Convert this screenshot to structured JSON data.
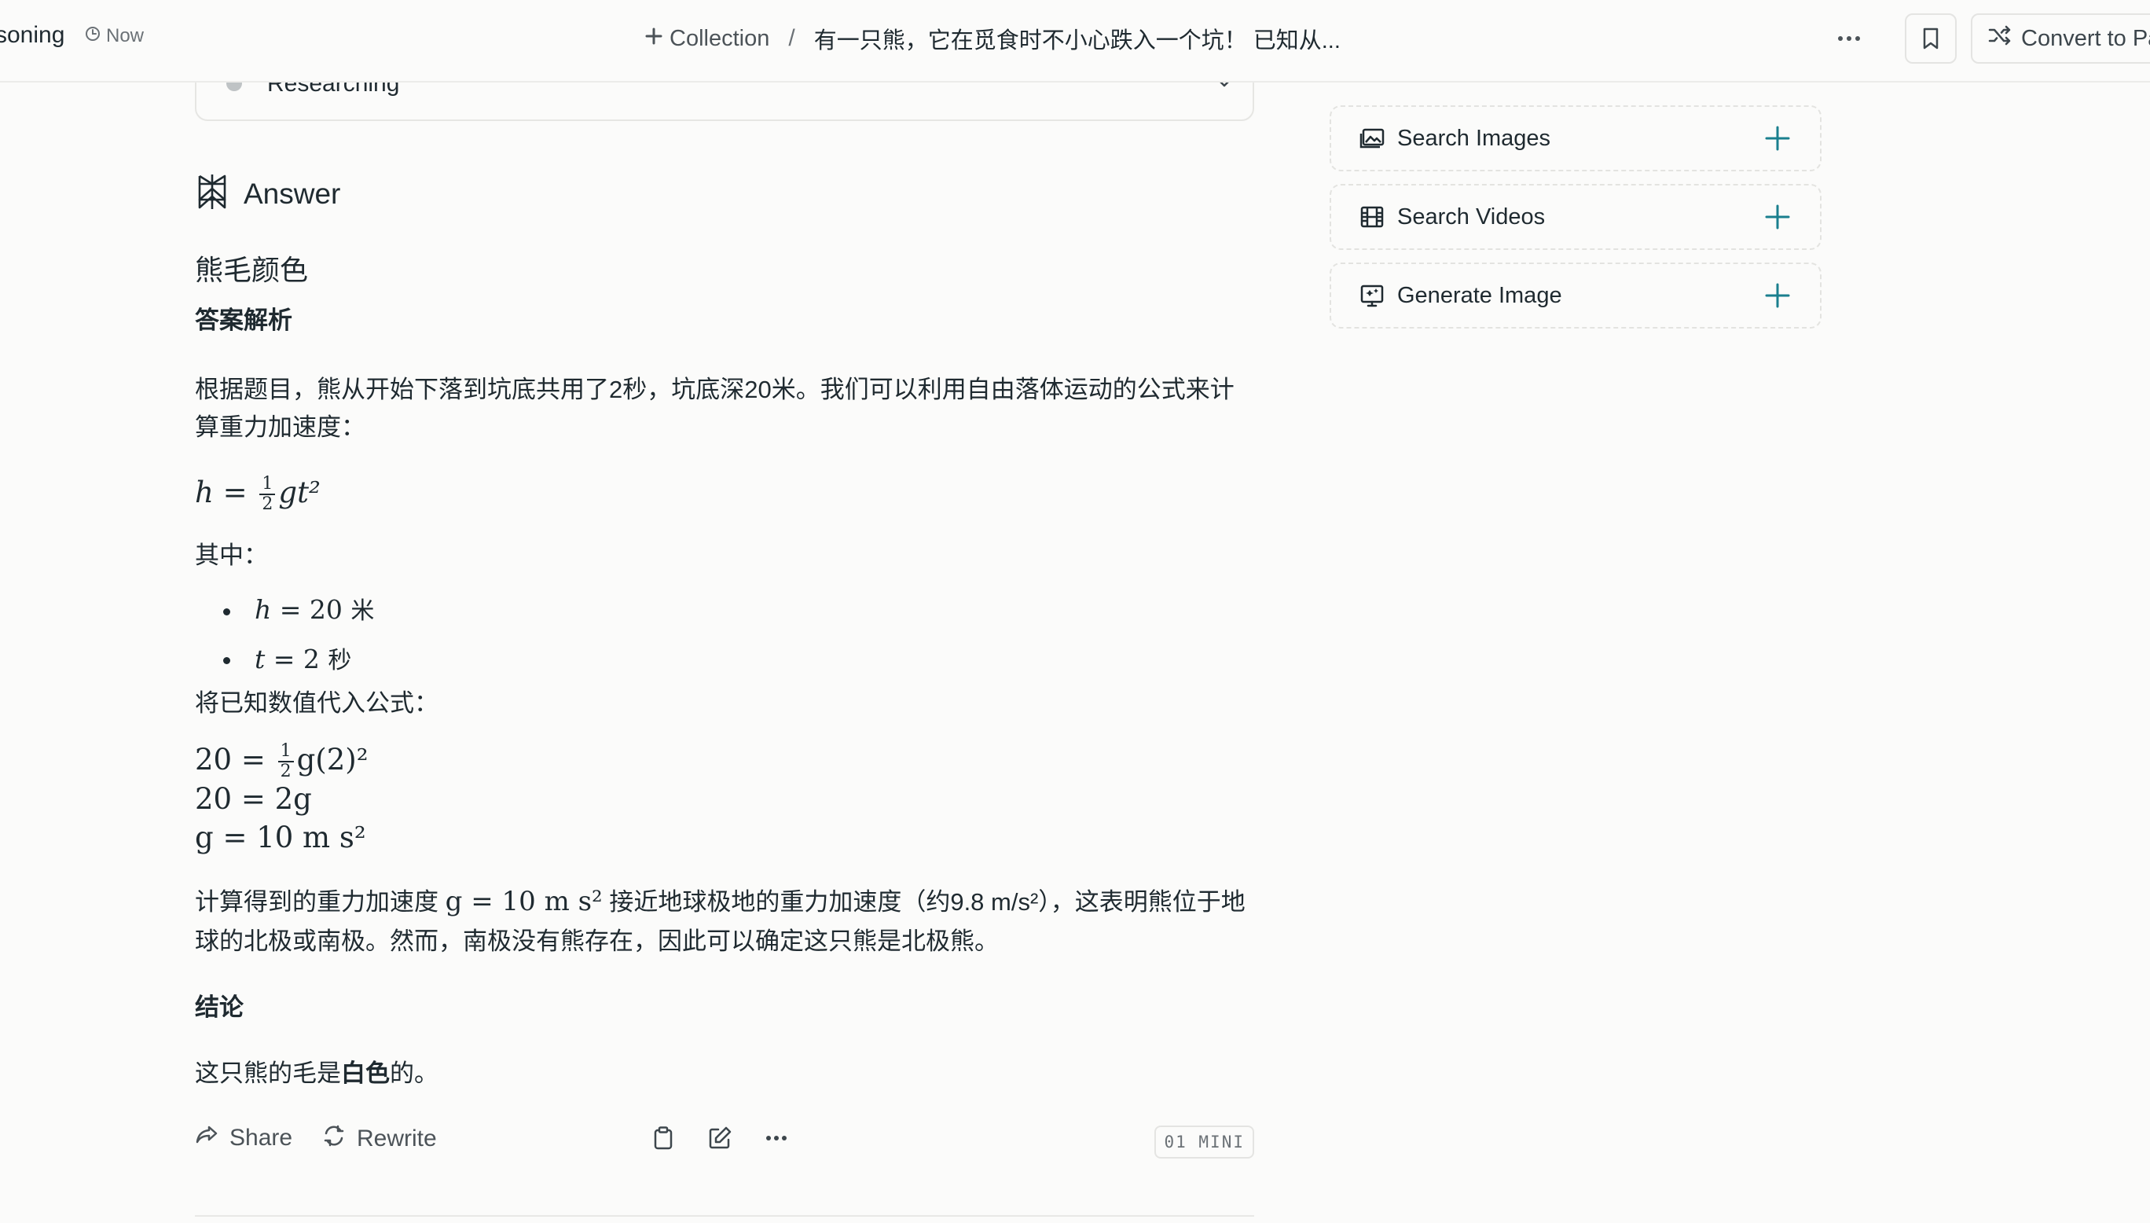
{
  "topbar": {
    "thread_title": "soning",
    "time": "Now",
    "breadcrumb": {
      "collection": "Collection",
      "separator": "/",
      "thread": "有一只熊，它在觅食时不小心跌入一个坑！ 已知从..."
    },
    "convert_label": "Convert to Pag"
  },
  "research": {
    "label": "Researching"
  },
  "answer": {
    "title": "Answer",
    "heading": "熊毛颜色",
    "subheading": "答案解析",
    "intro": "根据题目，熊从开始下落到坑底共用了2秒，坑底深20米。我们可以利用自由落体运动的公式来计算重力加速度：",
    "formula": {
      "lhs": "h",
      "eq": "=",
      "num": "1",
      "den": "2",
      "rhs": "gt²"
    },
    "where_label": "其中：",
    "givens": [
      {
        "var": "h",
        "value": " = 20 ",
        "unit": "米"
      },
      {
        "var": "t",
        "value": " = 2 ",
        "unit": "秒"
      }
    ],
    "substitute_label": "将已知数值代入公式：",
    "steps": [
      {
        "lhs": "20 =",
        "num": "1",
        "den": "2",
        "rhs": "g(2)²"
      },
      {
        "text": "20 = 2g"
      },
      {
        "text": "g = 10 m s²"
      }
    ],
    "result_prefix": "计算得到的重力加速度",
    "result_math": "g = 10 m s²",
    "result_suffix": "接近地球极地的重力加速度（约9.8 m/s²），这表明熊位于地球的北极或南极。然而，南极没有熊存在，因此可以确定这只熊是北极熊。",
    "conclusion_heading": "结论",
    "conclusion_prefix": "这只熊的毛是",
    "conclusion_bold": "白色",
    "conclusion_suffix": "的。"
  },
  "actions": {
    "share": "Share",
    "rewrite": "Rewrite",
    "model": "01 MINI"
  },
  "sidebar": {
    "items": [
      {
        "label": "Search Images",
        "icon": "image-icon"
      },
      {
        "label": "Search Videos",
        "icon": "film-icon"
      },
      {
        "label": "Generate Image",
        "icon": "generate-image-icon"
      }
    ]
  },
  "colors": {
    "background": "#fbfbfa",
    "text": "#1f2a30",
    "muted": "#6b7176",
    "accent": "#1a7f8e"
  }
}
